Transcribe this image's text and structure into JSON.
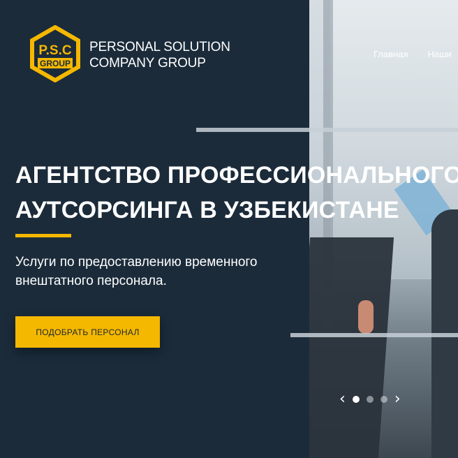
{
  "logo": {
    "line1": "P.S.C",
    "line2": "GROUP",
    "icon": "hexagon-logo-icon",
    "color": "#f5b800"
  },
  "brand": {
    "line1": "PERSONAL SOLUTION",
    "line2": "COMPANY GROUP"
  },
  "nav": {
    "items": [
      {
        "label": "Главная"
      },
      {
        "label": "Наши"
      }
    ]
  },
  "hero": {
    "title_line1": "АГЕНТСТВО ПРОФЕССИОНАЛЬНОГО",
    "title_line2": "АУТСОРСИНГА В УЗБЕКИСТАНЕ",
    "subtitle_line1": "Услуги по предоставлению временного",
    "subtitle_line2": "внештатного персонала.",
    "cta_label": "ПОДОБРАТЬ ПЕРСОНАЛ"
  },
  "slider": {
    "prev_icon": "chevron-left-icon",
    "next_icon": "chevron-right-icon",
    "prev_glyph": "‹",
    "next_glyph": "›",
    "slide_count": 3,
    "active_index": 0
  },
  "colors": {
    "background": "#1b2b3a",
    "accent": "#f5b800",
    "text": "#ffffff"
  }
}
